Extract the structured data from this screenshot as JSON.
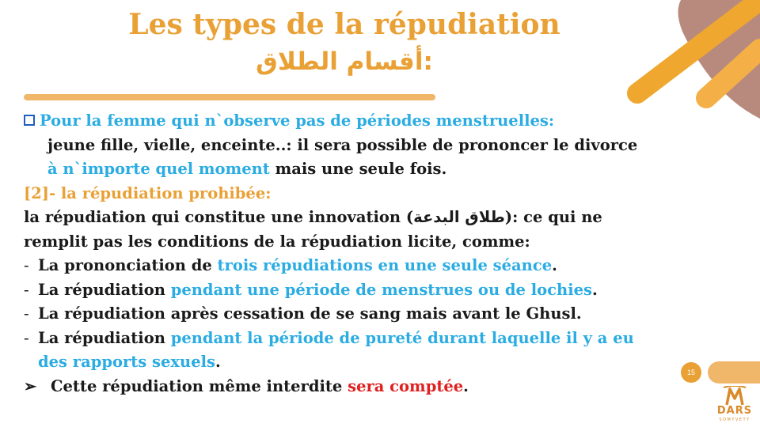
{
  "slide": {
    "title": "Les types de la répudiation",
    "title_arabic": "أقسام الطلاق:",
    "page_number": "15"
  },
  "content": {
    "line1": "Pour la femme qui n`observe pas de périodes menstruelles:",
    "line2": "jeune fille, vielle, enceinte..: il sera possible de prononcer le divorce",
    "line3_blue": "à n`importe quel moment",
    "line3_rest": " mais une seule fois.",
    "heading2": "[2]- la répudiation prohibée:",
    "p1_a": "la répudiation qui constitue une innovation (",
    "p1_arabic": "طلاق البدعة",
    "p1_b": "): ce qui ne",
    "p2": "remplit pas les conditions de la répudiation licite, comme:",
    "b1_a": "La prononciation de ",
    "b1_blue": "trois répudiations en une seule séance",
    "b1_end": ".",
    "b2_a": "La répudiation ",
    "b2_blue": "pendant une période de menstrues ou de lochies",
    "b2_end": ".",
    "b3": "La répudiation après cessation de se sang mais avant le Ghusl.",
    "b4_a": "La répudiation ",
    "b4_blue": "pendant la période de pureté durant laquelle il y a eu",
    "b4_blue2": "des rapports sexuels",
    "b4_end": ".",
    "last_a": "Cette répudiation même interdite ",
    "last_red": "sera comptée",
    "last_end": ".",
    "dash": "-",
    "arrow": "➢"
  },
  "logo": {
    "text": "DARS",
    "sub": "SOMYVETY"
  },
  "colors": {
    "accent_orange": "#e9a035",
    "accent_brown": "#b88a7e",
    "highlight_blue": "#2bace2",
    "highlight_red": "#e02020",
    "checkbox_blue": "#1f5fbf"
  },
  "icons": {
    "bullet1": "checkbox-icon",
    "bullet_last": "arrow-icon"
  }
}
